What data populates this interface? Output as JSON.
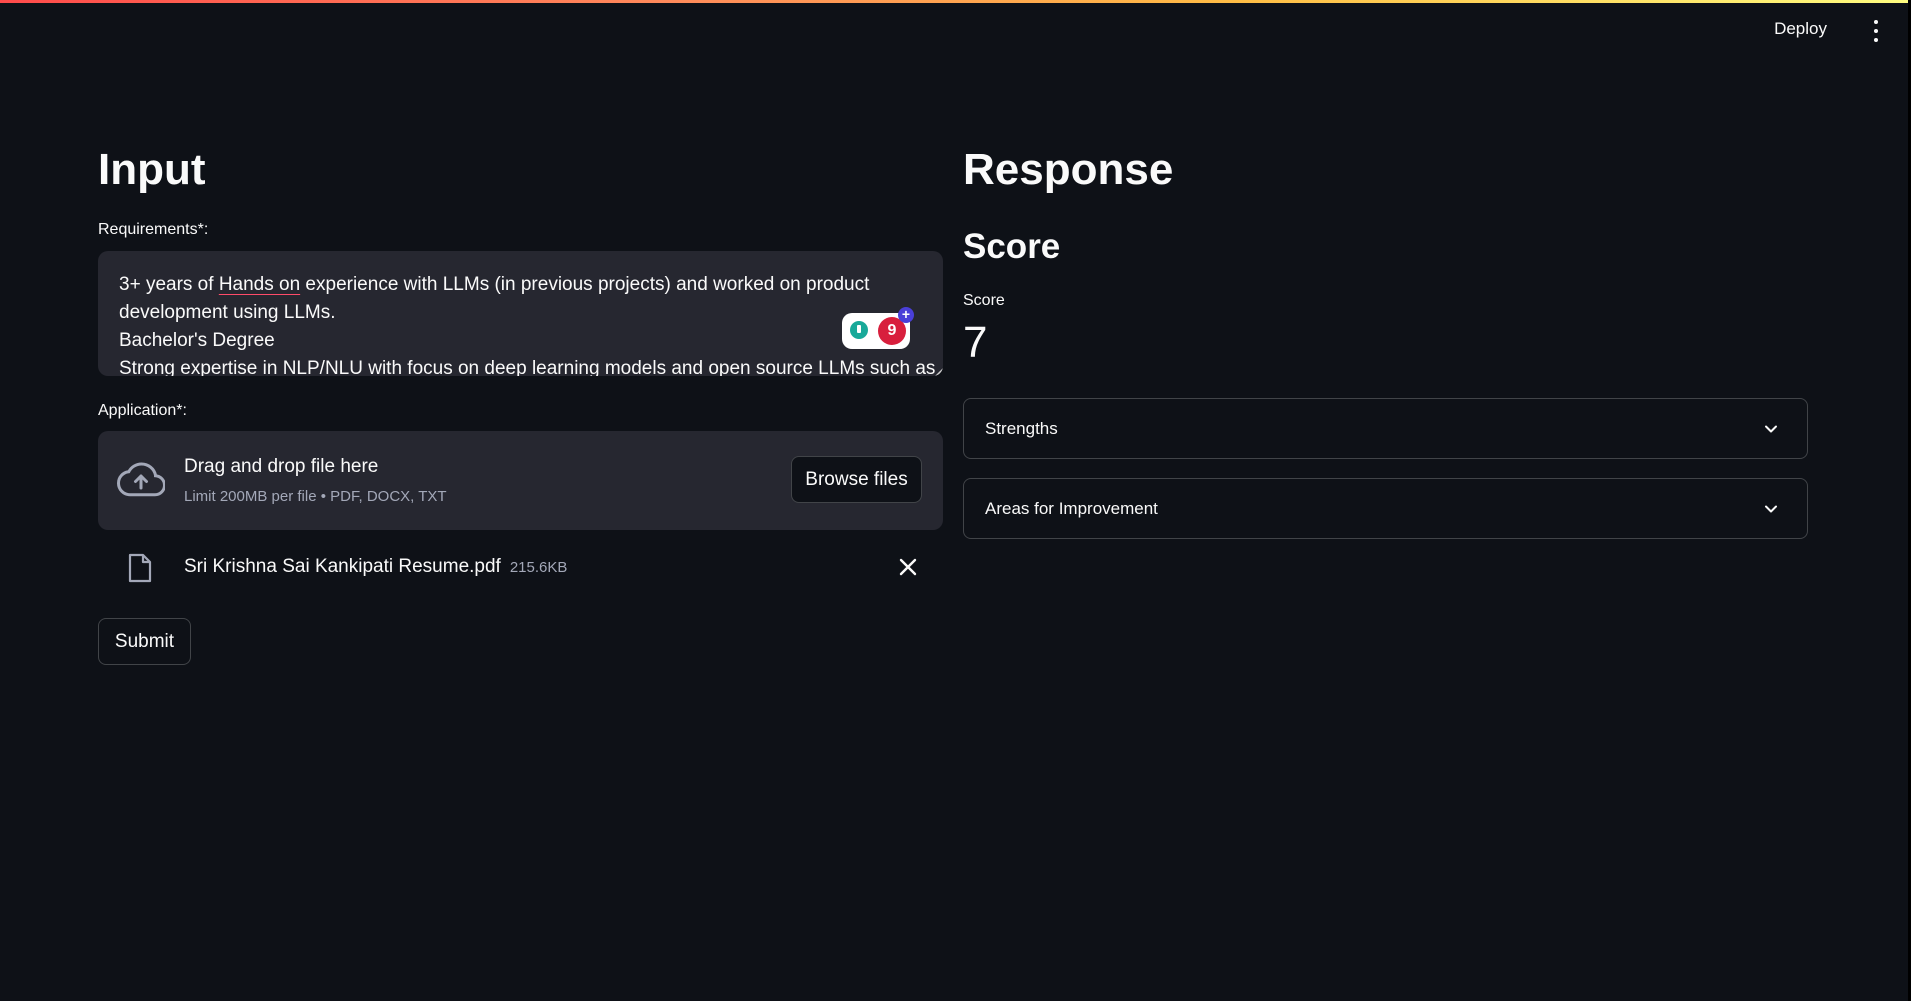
{
  "header": {
    "deploy_label": "Deploy",
    "menu_icon": "kebab-menu-icon"
  },
  "input": {
    "title": "Input",
    "requirements": {
      "label": "Requirements*:",
      "lines": [
        {
          "before": "3+ years of ",
          "underlined": "Hands on",
          "after": " experience with LLMs (in previous projects) and worked on product"
        },
        {
          "before": "development using LLMs.",
          "underlined": "",
          "after": ""
        },
        {
          "before": "Bachelor's Degree",
          "underlined": "",
          "after": ""
        },
        {
          "before": "Strong expertise in NLP/NLU with focus on deep learning models and open source LLMs such as",
          "underlined": "",
          "after": ""
        }
      ]
    },
    "extension_badge": {
      "count": "9",
      "plus": "+"
    },
    "application": {
      "label": "Application*:",
      "dropzone_title": "Drag and drop file here",
      "dropzone_subtitle": "Limit 200MB per file • PDF, DOCX, TXT",
      "browse_label": "Browse files",
      "icon": "cloud-upload-icon"
    },
    "uploaded_file": {
      "name": "Sri Krishna Sai Kankipati Resume.pdf",
      "size": "215.6KB",
      "icon": "file-icon",
      "remove_icon": "close-icon"
    },
    "submit_label": "Submit"
  },
  "response": {
    "title": "Response",
    "score_heading": "Score",
    "metric_label": "Score",
    "metric_value": "7",
    "expanders": [
      {
        "label": "Strengths",
        "expanded": false
      },
      {
        "label": "Areas for Improvement",
        "expanded": false
      }
    ]
  },
  "colors": {
    "background": "#0e1117",
    "surface": "#262730",
    "text": "#fafafa",
    "muted": "#a3a8b8",
    "accent_red": "#ff4b4b",
    "spell_underline": "#ff4b6a"
  }
}
